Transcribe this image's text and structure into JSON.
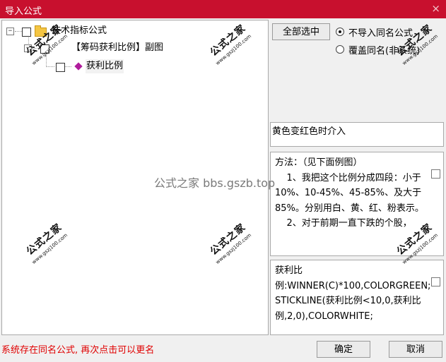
{
  "window": {
    "title": "导入公式",
    "close_glyph": "×"
  },
  "tree": {
    "items": [
      {
        "label": "技术指标公式",
        "expander": "−"
      },
      {
        "label": "【筹码获利比例】副图",
        "expander": "−"
      },
      {
        "label": "获利比例"
      }
    ]
  },
  "options": {
    "select_all_label": "全部选中",
    "radio_skip_label": "不导入同名公式",
    "radio_overwrite_label": "覆盖同名(非系统)",
    "selected": "skip"
  },
  "description": {
    "text": "黄色变红色时介入"
  },
  "method": {
    "text": "方法：（见下面例图）\n    1、我把这个比例分成四段：小于10%、10-45%、45-85%、及大于85%。分别用白、黄、红、粉表示。\n    2、对于前期一直下跌的个股，"
  },
  "code": {
    "text": "获利比例:WINNER(C)*100,COLORGREEN;\nSTICKLINE(获利比例<10,0,获利比例,2,0),COLORWHITE;"
  },
  "status": {
    "text": "系统存在同名公式, 再次点击可以更名"
  },
  "buttons": {
    "ok_label": "确定",
    "cancel_label": "取消"
  },
  "watermark": {
    "text": "公式之家 bbs.gszb.top",
    "stamp_text": "公式之家",
    "stamp_url": "www.gszj100.com"
  }
}
